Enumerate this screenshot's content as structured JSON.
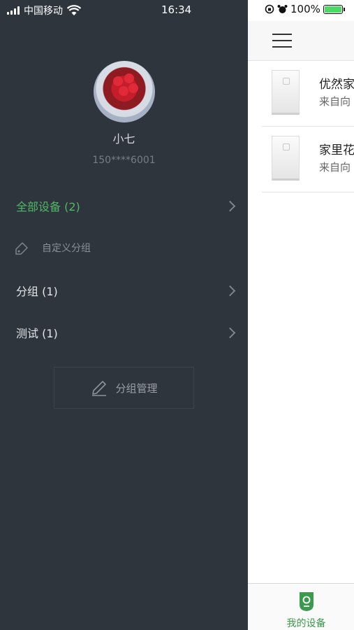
{
  "status": {
    "carrier": "中国移动",
    "time": "16:34",
    "battery": "100%"
  },
  "profile": {
    "name": "小七",
    "phone": "150****6001"
  },
  "menu": {
    "all_devices": "全部设备 (2)",
    "custom_group": "自定义分组",
    "groups": [
      {
        "label": "分组 (1)"
      },
      {
        "label": "测试 (1)"
      }
    ],
    "manage_button": "分组管理"
  },
  "devices": [
    {
      "name": "优然家",
      "subtitle": "来自向"
    },
    {
      "name": "家里花",
      "subtitle": "来自向"
    }
  ],
  "tabbar": {
    "my_devices": "我的设备"
  },
  "colors": {
    "drawer_bg": "#2f353d",
    "accent_green": "#4fb868",
    "tab_green": "#3b9a4e"
  }
}
